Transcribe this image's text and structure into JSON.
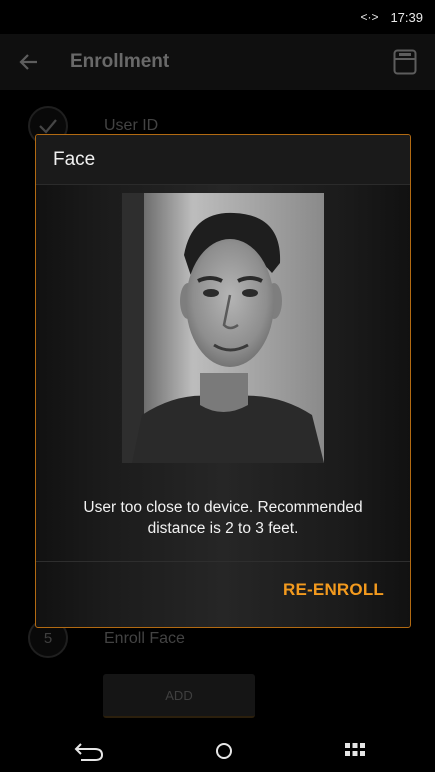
{
  "status_bar": {
    "sync_glyph": "<·>",
    "time": "17:39"
  },
  "app_bar": {
    "title": "Enrollment"
  },
  "steps": [
    {
      "number": "",
      "label": "User ID",
      "done": true
    },
    {
      "number": "5",
      "label": "Enroll Face",
      "done": false
    }
  ],
  "add_button": {
    "label": "ADD"
  },
  "dialog": {
    "title": "Face",
    "message_line1": "User too close to device. Recommended",
    "message_line2": "distance is 2 to 3 feet.",
    "action_label": "RE-ENROLL",
    "accent_color": "#f39a1e"
  },
  "icons": {
    "back": "arrow-left-icon",
    "save": "save-icon",
    "check": "check-icon",
    "nav_back": "back-arrow-icon",
    "nav_home": "home-circle-icon",
    "nav_apps": "apps-grid-icon"
  }
}
